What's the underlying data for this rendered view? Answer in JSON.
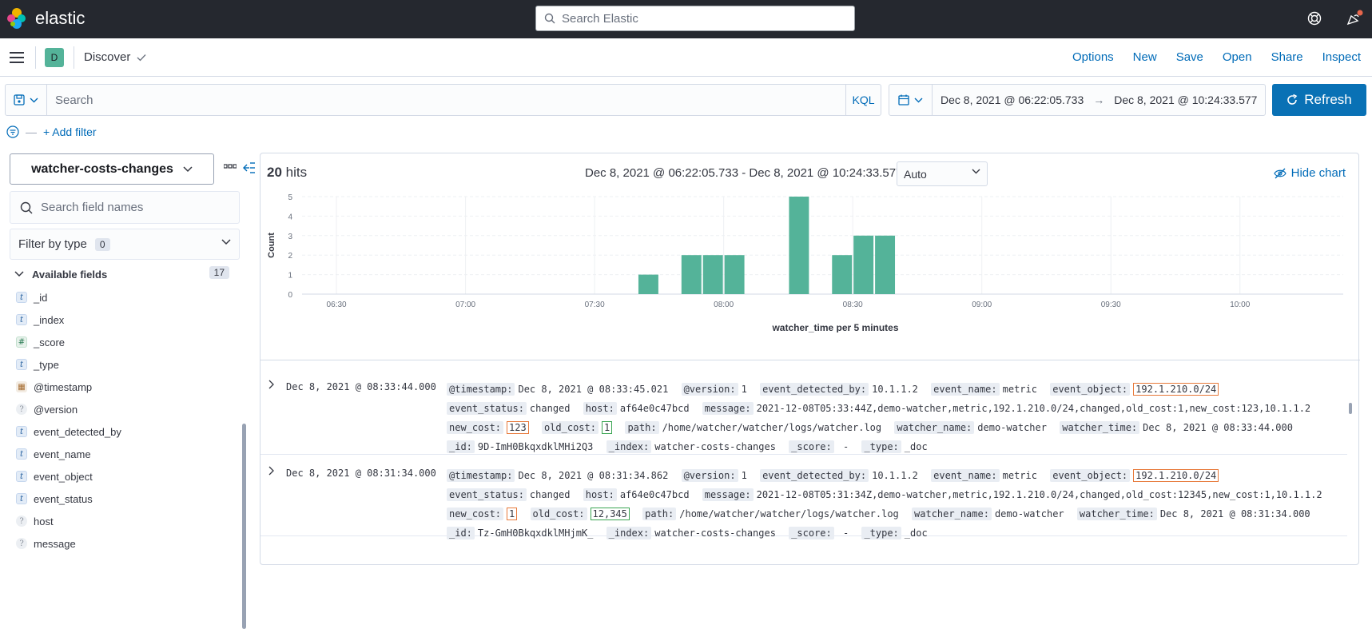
{
  "header": {
    "brand": "elastic",
    "search_placeholder": "Search Elastic"
  },
  "appbar": {
    "space_initial": "D",
    "breadcrumb": "Discover",
    "links": [
      "Options",
      "New",
      "Save",
      "Open",
      "Share",
      "Inspect"
    ]
  },
  "query": {
    "placeholder": "Search",
    "language": "KQL",
    "date_start": "Dec 8, 2021 @ 06:22:05.733",
    "date_arrow": "→",
    "date_end": "Dec 8, 2021 @ 10:24:33.577",
    "refresh_label": "Refresh",
    "add_filter": "+ Add filter"
  },
  "sidebar": {
    "index_pattern": "watcher-costs-changes",
    "field_search_placeholder": "Search field names",
    "filter_by_type": "Filter by type",
    "filter_count": "0",
    "available_label": "Available fields",
    "available_count": "17",
    "fields": [
      {
        "type": "t",
        "name": "_id"
      },
      {
        "type": "t",
        "name": "_index"
      },
      {
        "type": "#",
        "name": "_score"
      },
      {
        "type": "t",
        "name": "_type"
      },
      {
        "type": "date",
        "name": "@timestamp"
      },
      {
        "type": "?",
        "name": "@version"
      },
      {
        "type": "t",
        "name": "event_detected_by"
      },
      {
        "type": "t",
        "name": "event_name"
      },
      {
        "type": "t",
        "name": "event_object"
      },
      {
        "type": "t",
        "name": "event_status"
      },
      {
        "type": "?",
        "name": "host"
      },
      {
        "type": "?",
        "name": "message"
      }
    ]
  },
  "results": {
    "hits_count": "20",
    "hits_label": "hits",
    "range_label": "Dec 8, 2021 @ 06:22:05.733 - Dec 8, 2021 @ 10:24:33.577",
    "interval": "Auto",
    "hide_chart": "Hide chart"
  },
  "chart_data": {
    "type": "bar",
    "xlabel": "watcher_time per 5 minutes",
    "ylabel": "Count",
    "ylim": [
      0,
      5
    ],
    "yticks": [
      "0",
      "1",
      "2",
      "3",
      "4",
      "5"
    ],
    "xticks": [
      "06:30",
      "07:00",
      "07:30",
      "08:00",
      "08:30",
      "09:00",
      "09:30",
      "10:00"
    ],
    "bars": [
      {
        "x": "07:40",
        "value": 1
      },
      {
        "x": "07:50",
        "value": 2
      },
      {
        "x": "07:55",
        "value": 2
      },
      {
        "x": "08:00",
        "value": 2
      },
      {
        "x": "08:15",
        "value": 5
      },
      {
        "x": "08:25",
        "value": 2
      },
      {
        "x": "08:30",
        "value": 3
      },
      {
        "x": "08:35",
        "value": 3
      }
    ],
    "color": "#54b399",
    "grid": true
  },
  "documents": [
    {
      "time": "Dec 8, 2021 @ 08:33:44.000",
      "fields": [
        {
          "k": "@timestamp:",
          "v": "Dec 8, 2021 @ 08:33:45.021"
        },
        {
          "k": "@version:",
          "v": "1"
        },
        {
          "k": "event_detected_by:",
          "v": "10.1.1.2"
        },
        {
          "k": "event_name:",
          "v": "metric"
        },
        {
          "k": "event_object:",
          "v": "192.1.210.0/24",
          "hl": "o"
        },
        {
          "k": "event_status:",
          "v": "changed"
        },
        {
          "k": "host:",
          "v": "af64e0c47bcd"
        },
        {
          "k": "message:",
          "v": "2021-12-08T05:33:44Z,demo-watcher,metric,192.1.210.0/24,changed,old_cost:1,new_cost:123,10.1.1.2"
        },
        {
          "k": "new_cost:",
          "v": "123",
          "hl": "o"
        },
        {
          "k": "old_cost:",
          "v": "1",
          "hl": "g"
        },
        {
          "k": "path:",
          "v": "/home/watcher/watcher/logs/watcher.log"
        },
        {
          "k": "watcher_name:",
          "v": "demo-watcher"
        },
        {
          "k": "watcher_time:",
          "v": "Dec 8, 2021 @ 08:33:44.000"
        },
        {
          "k": "_id:",
          "v": "9D-ImH0BkqxdklMHi2Q3"
        },
        {
          "k": "_index:",
          "v": "watcher-costs-changes"
        },
        {
          "k": "_score:",
          "v": " - "
        },
        {
          "k": "_type:",
          "v": "_doc"
        }
      ]
    },
    {
      "time": "Dec 8, 2021 @ 08:31:34.000",
      "fields": [
        {
          "k": "@timestamp:",
          "v": "Dec 8, 2021 @ 08:31:34.862"
        },
        {
          "k": "@version:",
          "v": "1"
        },
        {
          "k": "event_detected_by:",
          "v": "10.1.1.2"
        },
        {
          "k": "event_name:",
          "v": "metric"
        },
        {
          "k": "event_object:",
          "v": "192.1.210.0/24",
          "hl": "o"
        },
        {
          "k": "event_status:",
          "v": "changed"
        },
        {
          "k": "host:",
          "v": "af64e0c47bcd"
        },
        {
          "k": "message:",
          "v": "2021-12-08T05:31:34Z,demo-watcher,metric,192.1.210.0/24,changed,old_cost:12345,new_cost:1,10.1.1.2"
        },
        {
          "k": "new_cost:",
          "v": "1",
          "hl": "o"
        },
        {
          "k": "old_cost:",
          "v": "12,345",
          "hl": "g"
        },
        {
          "k": "path:",
          "v": "/home/watcher/watcher/logs/watcher.log"
        },
        {
          "k": "watcher_name:",
          "v": "demo-watcher"
        },
        {
          "k": "watcher_time:",
          "v": "Dec 8, 2021 @ 08:31:34.000"
        },
        {
          "k": "_id:",
          "v": "Tz-GmH0BkqxdklMHjmK_"
        },
        {
          "k": "_index:",
          "v": "watcher-costs-changes"
        },
        {
          "k": "_score:",
          "v": " - "
        },
        {
          "k": "_type:",
          "v": "_doc"
        }
      ]
    }
  ]
}
